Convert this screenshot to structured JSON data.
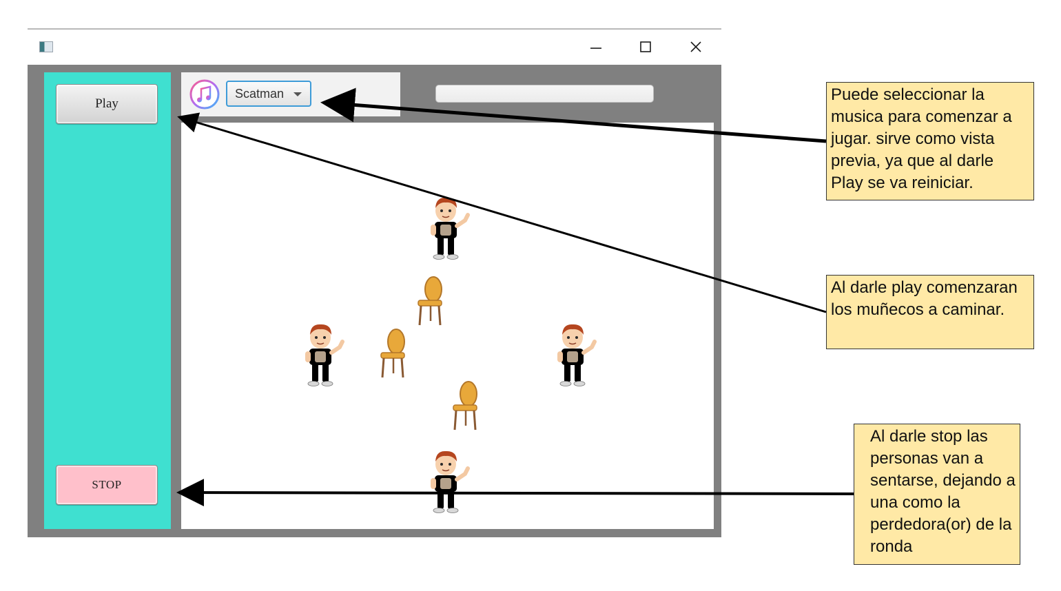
{
  "window": {
    "controls": {
      "minimize": "minimize-icon",
      "maximize": "maximize-icon",
      "close": "close-icon"
    }
  },
  "sidebar": {
    "play_label": "Play",
    "stop_label": "STOP",
    "background_color": "#3fe0d0",
    "stop_color": "#ffc0cb"
  },
  "toolbar": {
    "music_icon": "music-note-icon",
    "song_selected": "Scatman"
  },
  "progress": {
    "value": 0
  },
  "stage": {
    "players": [
      {
        "name": "boy-top",
        "shirt": "#5a6b7c",
        "pants": "#e53c2e"
      },
      {
        "name": "boy-left",
        "shirt": "#5a6b7c",
        "pants": "#e53c2e"
      },
      {
        "name": "boy-right",
        "shirt": "#5a6b7c",
        "pants": "#e53c2e"
      },
      {
        "name": "boy-bottom",
        "shirt": "#47b37b",
        "pants": "#666666"
      }
    ],
    "chairs": 3
  },
  "annotations": {
    "note1": "Puede seleccionar la musica para comenzar a jugar. sirve como vista previa, ya que al darle Play se va reiniciar.",
    "note2": "Al darle play comenzaran los muñecos a caminar.",
    "note3": "Al darle stop las personas van a sentarse, dejando a una como la perdedora(or) de la ronda"
  }
}
